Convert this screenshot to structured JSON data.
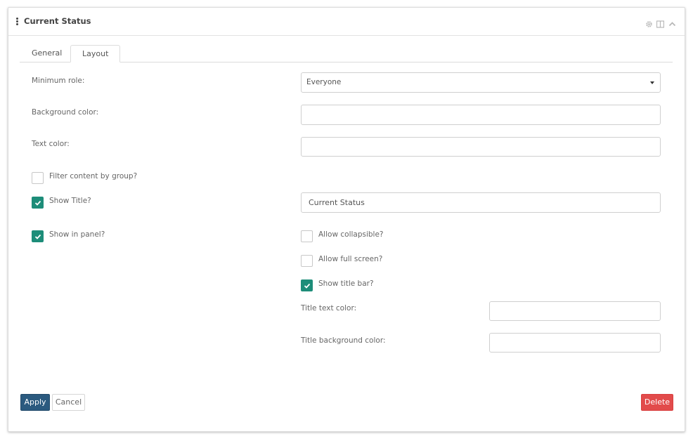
{
  "panel": {
    "title": "Current Status",
    "header_icons": [
      "gear-icon",
      "split-view-icon",
      "chevron-up-icon"
    ]
  },
  "tabs": [
    {
      "label": "General",
      "active": false
    },
    {
      "label": "Layout",
      "active": true
    }
  ],
  "form": {
    "minimum_role": {
      "label": "Minimum role:",
      "value": "Everyone"
    },
    "background_color": {
      "label": "Background color:",
      "value": ""
    },
    "text_color": {
      "label": "Text color:",
      "value": ""
    },
    "filter_by_group": {
      "label": "Filter content by group?",
      "checked": false
    },
    "show_title": {
      "label": "Show Title?",
      "checked": true,
      "title_value": "Current Status"
    },
    "show_in_panel": {
      "label": "Show in panel?",
      "checked": true
    },
    "allow_collapsible": {
      "label": "Allow collapsible?",
      "checked": false
    },
    "allow_full_screen": {
      "label": "Allow full screen?",
      "checked": false
    },
    "show_title_bar": {
      "label": "Show title bar?",
      "checked": true
    },
    "title_text_color": {
      "label": "Title text color:",
      "value": ""
    },
    "title_background_color": {
      "label": "Title background color:",
      "value": ""
    }
  },
  "buttons": {
    "apply": "Apply",
    "cancel": "Cancel",
    "delete": "Delete"
  },
  "colors": {
    "checkbox_checked": "#1d8d79",
    "apply_button": "#2b5a7f",
    "delete_button": "#e24b4b"
  }
}
